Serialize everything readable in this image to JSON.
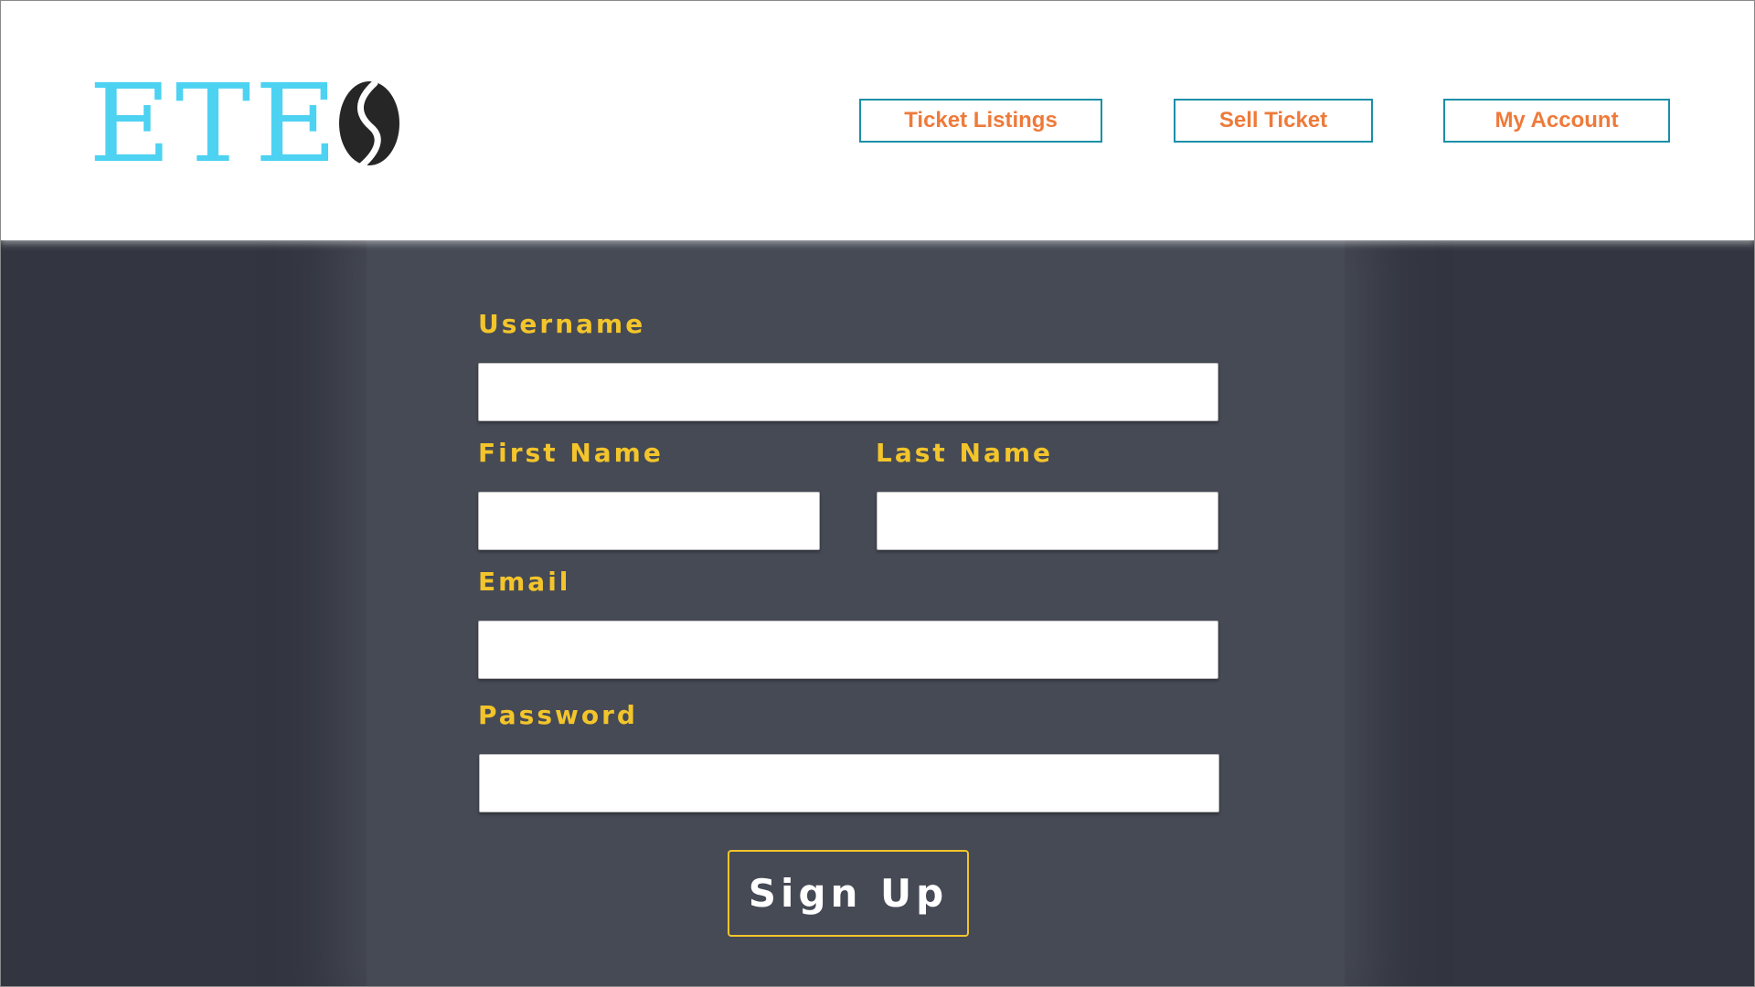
{
  "brand": {
    "logo_text": "ETE",
    "logo_mark_icon": "coffee-bean-s-icon",
    "logo_color": "#4dd2f2"
  },
  "nav": {
    "items": [
      {
        "label": "Ticket Listings"
      },
      {
        "label": "Sell Ticket"
      },
      {
        "label": "My Account"
      }
    ],
    "text_color": "#ee7a3a",
    "border_color": "#1a8fa8"
  },
  "form": {
    "username": {
      "label": "Username",
      "value": ""
    },
    "first_name": {
      "label": "First Name",
      "value": ""
    },
    "last_name": {
      "label": "Last Name",
      "value": ""
    },
    "email": {
      "label": "Email",
      "value": ""
    },
    "password": {
      "label": "Password",
      "value": ""
    },
    "submit_label": "Sign Up",
    "label_color": "#f3c52b"
  },
  "colors": {
    "background_dark": "#333640",
    "panel": "#464a55",
    "header": "#ffffff"
  }
}
